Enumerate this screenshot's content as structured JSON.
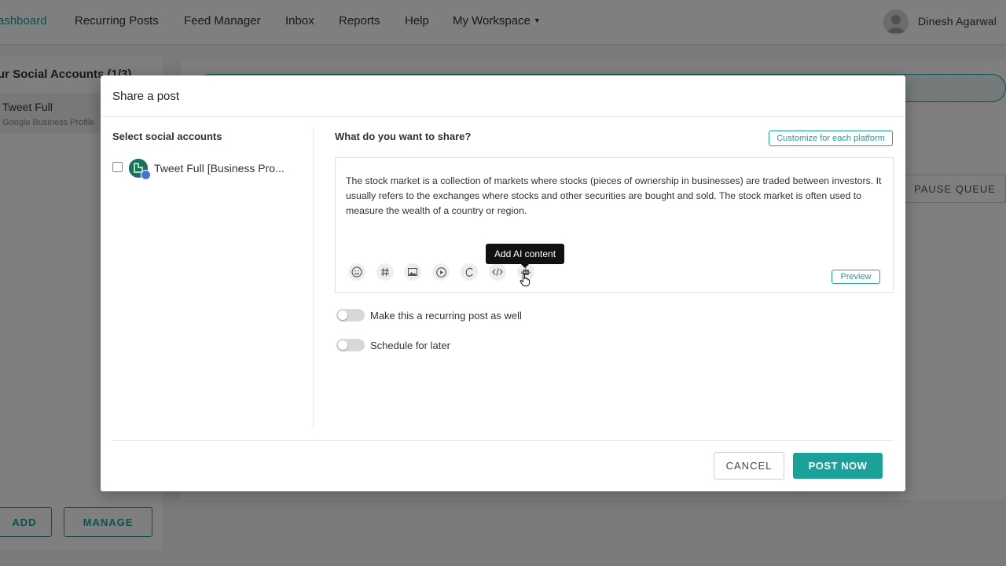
{
  "nav": {
    "items": [
      {
        "label": "ashboard",
        "active": true
      },
      {
        "label": "Recurring Posts"
      },
      {
        "label": "Feed Manager"
      },
      {
        "label": "Inbox"
      },
      {
        "label": "Reports"
      },
      {
        "label": "Help"
      },
      {
        "label": "My Workspace"
      }
    ],
    "user_name": "Dinesh Agarwal"
  },
  "left_panel": {
    "title": "ur Social Accounts (1/3)",
    "account_name": "Tweet Full",
    "account_type": "Google Business Profile",
    "add_label": "ADD",
    "manage_label": "MANAGE"
  },
  "background": {
    "pause_queue_label": "PAUSE QUEUE"
  },
  "modal": {
    "title": "Share a post",
    "select_accounts_label": "Select social accounts",
    "account_option": "Tweet Full [Business Pro...",
    "share_label": "What do you want to share?",
    "customize_label": "Customize for each platform",
    "post_text": "The stock market is a collection of markets where stocks (pieces of ownership in businesses) are traded between investors. It usually refers to the exchanges where stocks and other securities are bought and sold. The stock market is often used to measure the wealth of a country or region.",
    "tooltip": "Add AI content",
    "preview_label": "Preview",
    "toolbar_icons": [
      "emoji-icon",
      "hashtag-icon",
      "image-icon",
      "video-icon",
      "canva-icon",
      "code-icon",
      "ai-content-icon"
    ],
    "recurring_label": "Make this a recurring post as well",
    "schedule_label": "Schedule for later",
    "cancel_label": "CANCEL",
    "post_label": "POST NOW"
  },
  "colors": {
    "accent": "#1aa29a",
    "overlay": "rgba(0,0,0,0.5)"
  }
}
